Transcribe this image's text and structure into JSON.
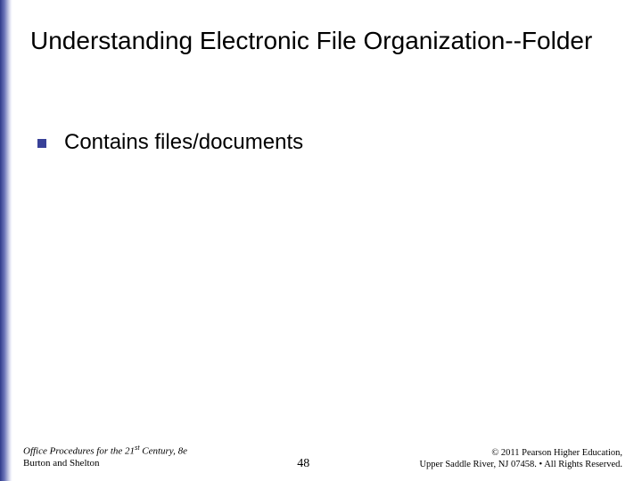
{
  "slide": {
    "title": "Understanding Electronic File Organization--Folder",
    "bullets": [
      {
        "text": "Contains files/documents"
      }
    ]
  },
  "footer": {
    "left": {
      "book_title_prefix": "Office Procedures for the 21",
      "book_title_super": "st",
      "book_title_suffix": " Century, 8e",
      "authors": "Burton and Shelton"
    },
    "center": {
      "page_number": "48"
    },
    "right": {
      "line1": "© 2011 Pearson Higher Education,",
      "line2": "Upper Saddle River, NJ 07458. • All Rights Reserved."
    }
  }
}
